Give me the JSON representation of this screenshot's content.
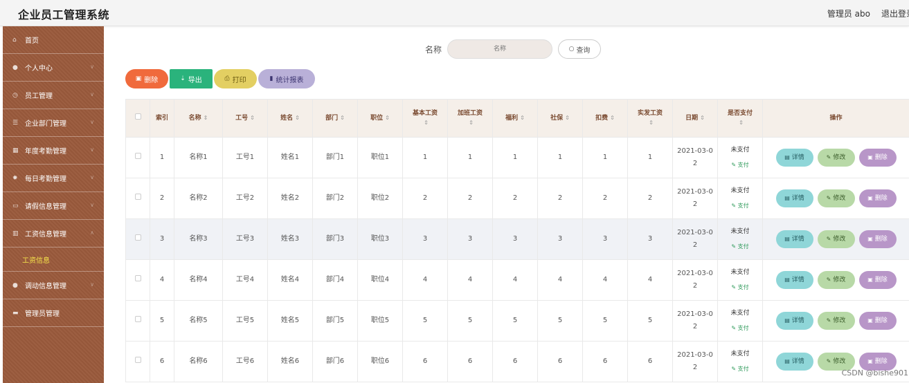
{
  "header": {
    "title": "企业员工管理系统",
    "admin": "管理员 abo",
    "logout": "退出登录"
  },
  "sidebar": {
    "items": [
      {
        "icon": "home-icon",
        "glyph": "⌂",
        "label": "首页",
        "has_chevron": false
      },
      {
        "icon": "user-icon",
        "glyph": "●",
        "label": "个人中心",
        "has_chevron": true
      },
      {
        "icon": "clock-icon",
        "glyph": "◷",
        "label": "员工管理",
        "has_chevron": true
      },
      {
        "icon": "list-icon",
        "glyph": "☰",
        "label": "企业部门管理",
        "has_chevron": true
      },
      {
        "icon": "bank-icon",
        "glyph": "▦",
        "label": "年度考勤管理",
        "has_chevron": true
      },
      {
        "icon": "gear-icon",
        "glyph": "✹",
        "label": "每日考勤管理",
        "has_chevron": true
      },
      {
        "icon": "message-icon",
        "glyph": "▭",
        "label": "请假信息管理",
        "has_chevron": true
      },
      {
        "icon": "bar-chart-icon",
        "glyph": "▥",
        "label": "工资信息管理",
        "has_chevron": true,
        "expanded": true
      }
    ],
    "sub_item": "工资信息",
    "items_after": [
      {
        "icon": "person-icon",
        "glyph": "●",
        "label": "调动信息管理",
        "has_chevron": true
      },
      {
        "icon": "shield-icon",
        "glyph": "▬",
        "label": "管理员管理",
        "has_chevron": false
      }
    ]
  },
  "search": {
    "label": "名称",
    "placeholder": "名称",
    "button": "查询"
  },
  "toolbar": {
    "delete": "删除",
    "export": "导出",
    "print": "打印",
    "report": "统计报表"
  },
  "table": {
    "headers": {
      "index": "索引",
      "name": "名称",
      "job_no": "工号",
      "full_name": "姓名",
      "dept": "部门",
      "position": "职位",
      "base_salary_1": "基本工资",
      "overtime_1": "加班工资",
      "welfare": "福利",
      "social": "社保",
      "deduction": "扣费",
      "actual_1": "实发工资",
      "date": "日期",
      "paid_1": "是否支付",
      "ops": "操作"
    },
    "rows": [
      {
        "index": "1",
        "name": "名称1",
        "job_no": "工号1",
        "full_name": "姓名1",
        "dept": "部门1",
        "position": "职位1",
        "base": "1",
        "overtime": "1",
        "welfare": "1",
        "social": "1",
        "deduction": "1",
        "actual": "1",
        "date_a": "2021-03-0",
        "date_b": "2",
        "paid": "未支付",
        "pay": "支付"
      },
      {
        "index": "2",
        "name": "名称2",
        "job_no": "工号2",
        "full_name": "姓名2",
        "dept": "部门2",
        "position": "职位2",
        "base": "2",
        "overtime": "2",
        "welfare": "2",
        "social": "2",
        "deduction": "2",
        "actual": "2",
        "date_a": "2021-03-0",
        "date_b": "2",
        "paid": "未支付",
        "pay": "支付"
      },
      {
        "index": "3",
        "name": "名称3",
        "job_no": "工号3",
        "full_name": "姓名3",
        "dept": "部门3",
        "position": "职位3",
        "base": "3",
        "overtime": "3",
        "welfare": "3",
        "social": "3",
        "deduction": "3",
        "actual": "3",
        "date_a": "2021-03-0",
        "date_b": "2",
        "paid": "未支付",
        "pay": "支付"
      },
      {
        "index": "4",
        "name": "名称4",
        "job_no": "工号4",
        "full_name": "姓名4",
        "dept": "部门4",
        "position": "职位4",
        "base": "4",
        "overtime": "4",
        "welfare": "4",
        "social": "4",
        "deduction": "4",
        "actual": "4",
        "date_a": "2021-03-0",
        "date_b": "2",
        "paid": "未支付",
        "pay": "支付"
      },
      {
        "index": "5",
        "name": "名称5",
        "job_no": "工号5",
        "full_name": "姓名5",
        "dept": "部门5",
        "position": "职位5",
        "base": "5",
        "overtime": "5",
        "welfare": "5",
        "social": "5",
        "deduction": "5",
        "actual": "5",
        "date_a": "2021-03-0",
        "date_b": "2",
        "paid": "未支付",
        "pay": "支付"
      },
      {
        "index": "6",
        "name": "名称6",
        "job_no": "工号6",
        "full_name": "姓名6",
        "dept": "部门6",
        "position": "职位6",
        "base": "6",
        "overtime": "6",
        "welfare": "6",
        "social": "6",
        "deduction": "6",
        "actual": "6",
        "date_a": "2021-03-0",
        "date_b": "2",
        "paid": "未支付",
        "pay": "支付"
      }
    ],
    "row_buttons": {
      "detail": "详情",
      "edit": "修改",
      "delete": "删除"
    }
  },
  "watermark": "CSDN @bishe901",
  "colors": {
    "sidebar": "#9a5a3c",
    "delete": "#f06a3c",
    "export": "#2ab37c",
    "print": "#e3cf62",
    "report": "#b9b0d8"
  }
}
